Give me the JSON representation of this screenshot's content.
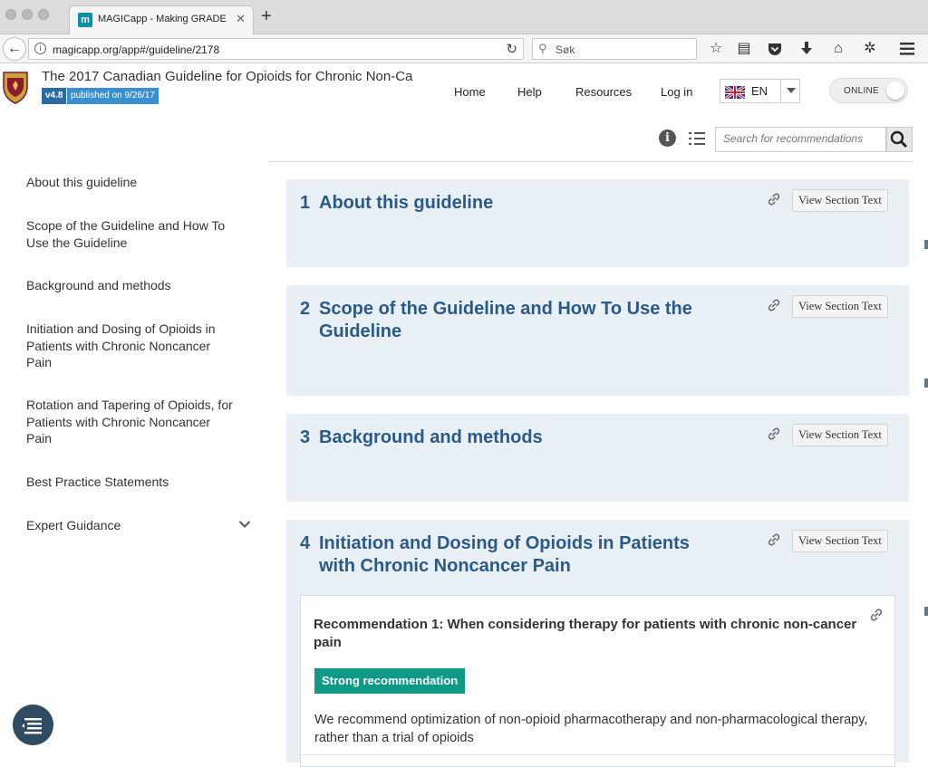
{
  "browser": {
    "tab_title": "MAGICapp - Making GRADE t",
    "tab_favicon": "m",
    "url": "magicapp.org/app#/guideline/2178",
    "search_placeholder": "Søk",
    "icons": [
      "back-arrow-icon",
      "info-icon",
      "reload-icon",
      "search-icon",
      "star-icon",
      "reading-list-icon",
      "pocket-icon",
      "download-icon",
      "home-icon",
      "extension-icon",
      "menu-icon"
    ]
  },
  "app": {
    "title": "The 2017 Canadian Guideline for Opioids for Chronic Non-Ca",
    "version": "v4.8",
    "published": "published on 9/26/17",
    "nav": [
      "Home",
      "Help",
      "Resources",
      "Log in"
    ],
    "language": "EN",
    "online_label": "ONLINE",
    "rec_search_placeholder": "Search for recommendations"
  },
  "sidebar": {
    "items": [
      {
        "label": "About this guideline"
      },
      {
        "label": "Scope of the Guideline and How To Use the Guideline"
      },
      {
        "label": "Background and methods"
      },
      {
        "label": "Initiation and Dosing of Opioids in Patients with Chronic Noncancer Pain"
      },
      {
        "label": "Rotation and Tapering of Opioids, for Patients with Chronic Noncancer Pain"
      },
      {
        "label": "Best Practice Statements"
      },
      {
        "label": "Expert Guidance"
      }
    ]
  },
  "sections": [
    {
      "num": "1",
      "title": "About this guideline",
      "button": "View Section Text"
    },
    {
      "num": "2",
      "title": "Scope of the Guideline and How To Use the Guideline",
      "button": "View Section Text"
    },
    {
      "num": "3",
      "title": "Background and methods",
      "button": "View Section Text"
    },
    {
      "num": "4",
      "title": "Initiation and Dosing of Opioids in Patients with Chronic Noncancer Pain",
      "button": "View Section Text"
    }
  ],
  "recommendation": {
    "title": "Recommendation 1: When considering therapy for patients with chronic non-cancer pain",
    "strength": "Strong recommendation",
    "text": "We recommend optimization of non-opioid pharmacotherapy and non-pharmacological therapy, rather than a trial of opioids"
  },
  "colors": {
    "section_bg": "#e8f0f6",
    "section_title": "#2a5a8a",
    "strong_badge": "#0f9a88",
    "version_badge": "#2b6aa3",
    "published_badge": "#3a8fd0"
  }
}
